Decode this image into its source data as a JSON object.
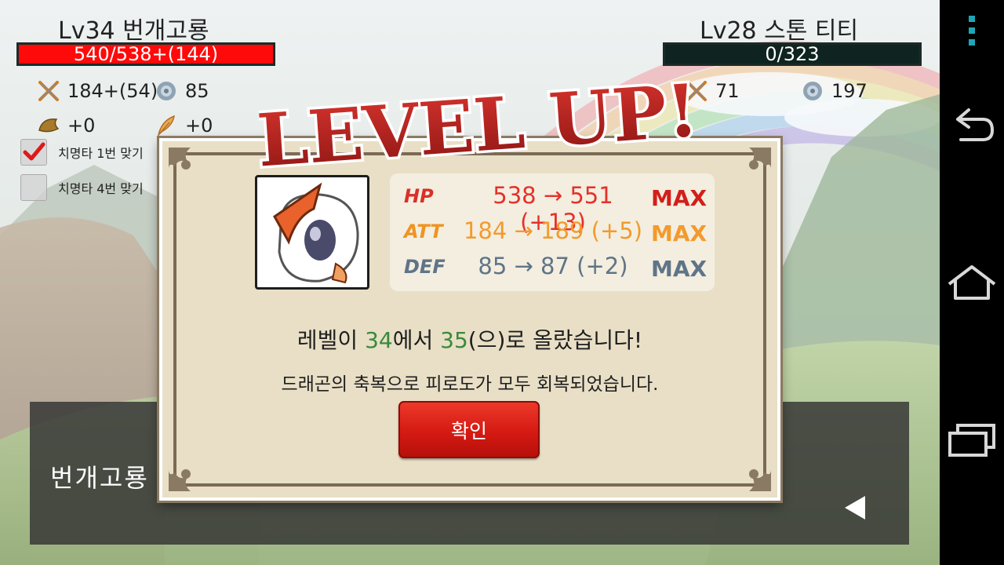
{
  "player": {
    "name": "Lv34 번개고룡",
    "hp_text": "540/538+(144)",
    "hp_fill": 1.0,
    "attack": "184+(54)",
    "defense": "85",
    "bonus1": "+0",
    "bonus2": "+0"
  },
  "enemy": {
    "name": "Lv28 스톤 티티",
    "hp_text": "0/323",
    "hp_fill": 0.0,
    "attack": "71",
    "defense": "197"
  },
  "checks": [
    {
      "label": "치명타 1번 맞기",
      "checked": true
    },
    {
      "label": "치명타 4번 맞기",
      "checked": false
    }
  ],
  "message_panel": {
    "text": "번개고룡"
  },
  "dialog": {
    "title": "LEVEL UP!",
    "stats": [
      {
        "label": "HP",
        "value": "538 → 551 (+13)",
        "max": "MAX",
        "color": "#e5312a",
        "label_color": "#d93028"
      },
      {
        "label": "ATT",
        "value": "184 → 189 (+5)",
        "max": "MAX",
        "color": "#f39a2c",
        "label_color": "#f09323"
      },
      {
        "label": "DEF",
        "value": "85 → 87 (+2)",
        "max": "MAX",
        "color": "#5f7487",
        "label_color": "#5f7487"
      }
    ],
    "message_prefix": "레벨이 ",
    "level_from": "34",
    "message_mid": "에서 ",
    "level_to": "35",
    "message_suffix": "(으)로 올랐습니다!",
    "message2": "드래곤의 축복으로 피로도가 모두 회복되었습니다.",
    "confirm_label": "확인"
  },
  "colors": {
    "player_hp": "#ff0a0a",
    "enemy_hp": "#0f2420",
    "dialog_bg": "#e8dfc6",
    "confirm": "#d41a12",
    "level_green": "#3a8a3a",
    "nav_accent": "#1fa5b8"
  },
  "icons": {
    "attack": "crossed-swords-icon",
    "defense": "shield-icon",
    "bonus1": "horn-icon",
    "bonus2": "feather-icon",
    "nav_menu": "overflow-menu-icon",
    "nav_back": "back-icon",
    "nav_home": "home-icon",
    "nav_recent": "recent-apps-icon"
  }
}
